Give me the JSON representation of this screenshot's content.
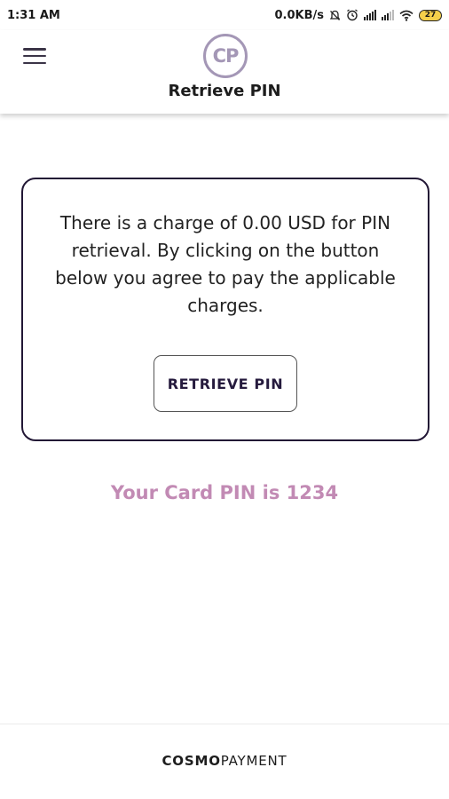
{
  "status_bar": {
    "time": "1:31 AM",
    "network_speed": "0.0KB/s",
    "battery_level": "27",
    "icons": [
      "alarm-off-icon",
      "alarm-clock-icon",
      "signal-icon",
      "signal-icon",
      "wifi-icon",
      "battery-icon"
    ]
  },
  "header": {
    "menu_icon": "hamburger-menu-icon",
    "logo_text": "CP",
    "title": "Retrieve PIN"
  },
  "card": {
    "message": "There is a charge of 0.00 USD for PIN retrieval. By clicking on the button below you agree to pay the applicable charges.",
    "button_label": "RETRIEVE PIN"
  },
  "result": {
    "text": "Your Card PIN is 1234"
  },
  "footer": {
    "brand_bold": "COSMO",
    "brand_light": "PAYMENT"
  },
  "colors": {
    "card_border": "#221735",
    "pin_text": "#c28ab4",
    "logo": "#a497b6",
    "button_text": "#251a3d"
  }
}
